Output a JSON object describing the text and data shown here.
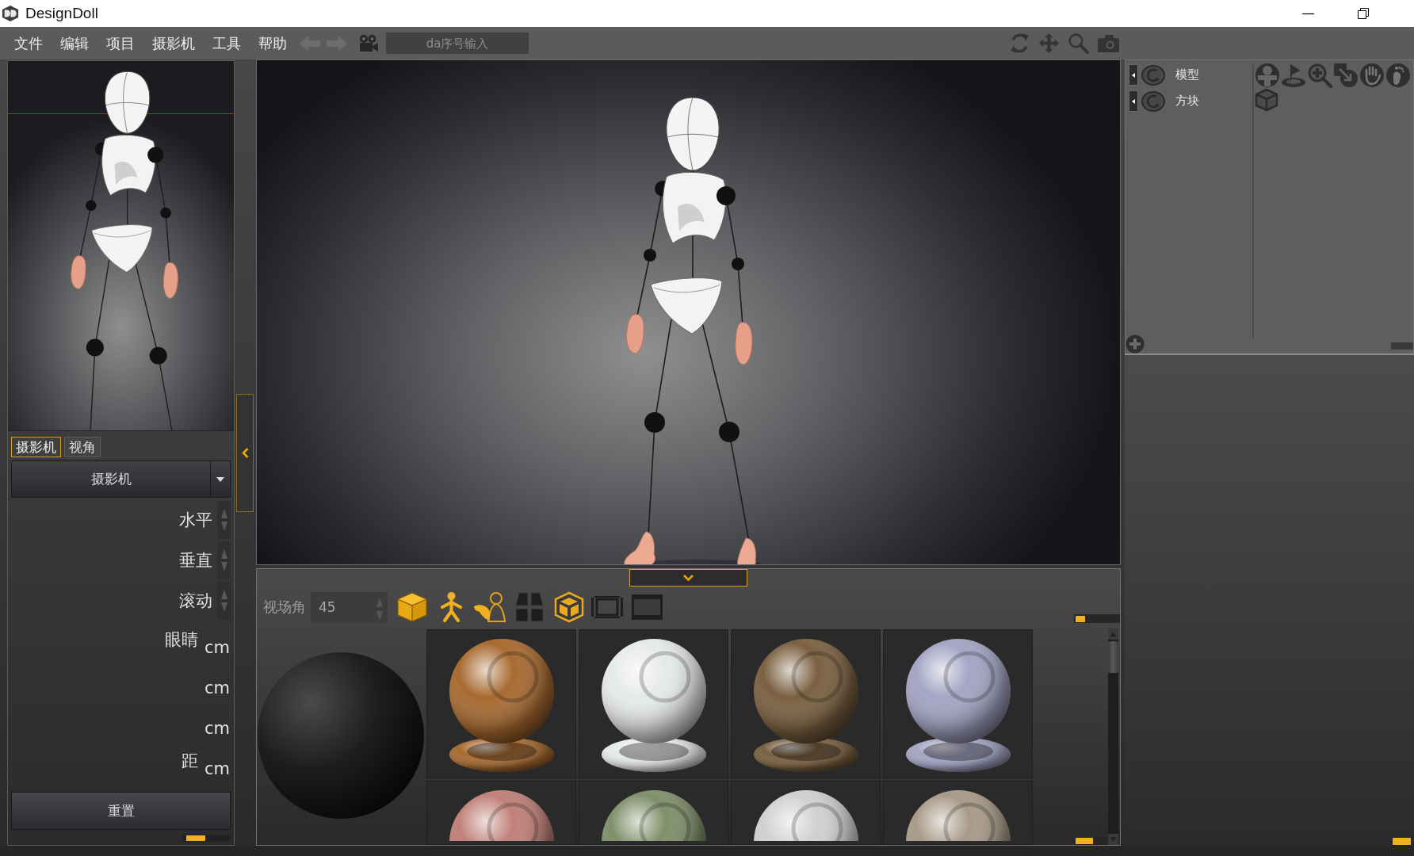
{
  "window": {
    "title": "DesignDoll"
  },
  "menu": [
    "文件",
    "编辑",
    "项目",
    "摄影机",
    "工具",
    "帮助"
  ],
  "toolbar": {
    "serial_field": {
      "placeholder": "da序号输入"
    }
  },
  "camera_panel": {
    "tabs": [
      {
        "label": "摄影机",
        "selected": true
      },
      {
        "label": "视角",
        "selected": false
      }
    ],
    "camera_select": {
      "value": "摄影机"
    },
    "spin_rows": [
      {
        "label": "水平"
      },
      {
        "label": "垂直"
      },
      {
        "label": "滚动"
      }
    ],
    "unit_rows": [
      {
        "label": "眼睛",
        "unit": "cm"
      },
      {
        "unit": "cm"
      },
      {
        "unit": "cm"
      },
      {
        "label": "距",
        "unit": "cm"
      }
    ],
    "reset_button": {
      "label": "重置"
    }
  },
  "material_panel": {
    "fov": {
      "label": "视场角",
      "value": "45"
    },
    "materials": [
      {
        "color": "#a86a30"
      },
      {
        "color": "#e6eae6"
      },
      {
        "color": "#7a6040"
      },
      {
        "color": "#a4a4c4"
      },
      {
        "color": "#c08078"
      },
      {
        "color": "#7f8f6a"
      },
      {
        "color": "#d0d0d0"
      },
      {
        "color": "#a89a88"
      }
    ]
  },
  "layer_panel": {
    "layers": [
      {
        "label": "模型"
      },
      {
        "label": "方块"
      }
    ]
  }
}
